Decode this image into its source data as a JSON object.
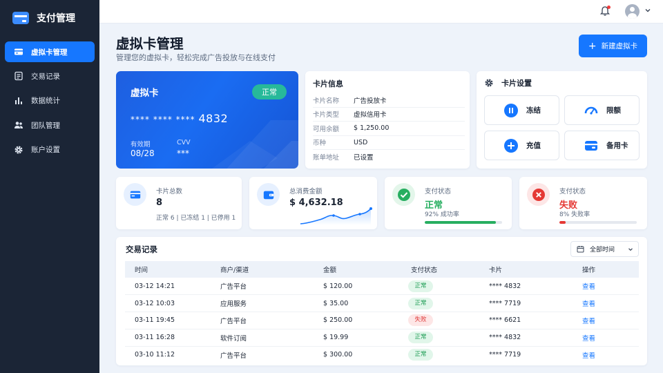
{
  "app": {
    "name": "支付管理"
  },
  "sidebar": {
    "items": [
      {
        "label": "虚拟卡管理",
        "icon": "card-icon",
        "active": true
      },
      {
        "label": "交易记录",
        "icon": "list-icon",
        "active": false
      },
      {
        "label": "数据统计",
        "icon": "bar-chart-icon",
        "active": false
      },
      {
        "label": "团队管理",
        "icon": "team-icon",
        "active": false
      },
      {
        "label": "账户设置",
        "icon": "gear-icon",
        "active": false
      }
    ]
  },
  "header": {
    "title": "虚拟卡管理",
    "subtitle": "管理您的虚拟卡，轻松完成广告投放与在线支付",
    "new_button": "新建虚拟卡"
  },
  "virtual_card": {
    "title": "虚拟卡",
    "status": "正常",
    "masked": "****   ****   ****",
    "last4": "4832",
    "expiry_label": "有效期",
    "expiry": "08/28",
    "cvv_label": "CVV",
    "cvv": "***"
  },
  "card_info": {
    "title": "卡片信息",
    "rows": [
      {
        "key": "卡片名称",
        "value": "广告投放卡"
      },
      {
        "key": "卡片类型",
        "value": "虚拟信用卡"
      },
      {
        "key": "可用余额",
        "value": "$ 1,250.00"
      },
      {
        "key": "币种",
        "value": "USD"
      },
      {
        "key": "账单地址",
        "value": "已设置"
      }
    ]
  },
  "card_settings": {
    "title": "卡片设置",
    "buttons": [
      {
        "label": "冻结",
        "icon": "pause-icon"
      },
      {
        "label": "限额",
        "icon": "gauge-icon"
      },
      {
        "label": "充值",
        "icon": "plus-icon"
      },
      {
        "label": "备用卡",
        "icon": "card-icon"
      }
    ]
  },
  "stats": {
    "total_cards": {
      "label": "卡片总数",
      "value": "8",
      "sub": "正常 6 | 已冻结 1 | 已停用 1"
    },
    "total_spend": {
      "label": "总消费金额",
      "value": "$ 4,632.18"
    },
    "pay_ok": {
      "label": "支付状态",
      "value": "正常",
      "sub": "92% 成功率",
      "progress": 0.92,
      "color": "#27ae60"
    },
    "pay_fail": {
      "label": "支付状态",
      "value": "失败",
      "sub": "8% 失败率",
      "progress": 0.08,
      "color": "#e53935"
    }
  },
  "transactions": {
    "title": "交易记录",
    "filter": "全部时间",
    "columns": [
      "时间",
      "商户/渠道",
      "金额",
      "支付状态",
      "卡片",
      "操作"
    ],
    "rows": [
      {
        "time": "03-12 14:21",
        "merchant": "广告平台",
        "amount": "$ 120.00",
        "status": "正常",
        "card": "**** 4832",
        "action": "查看"
      },
      {
        "time": "03-12 10:03",
        "merchant": "应用服务",
        "amount": "$ 35.00",
        "status": "正常",
        "card": "**** 7719",
        "action": "查看"
      },
      {
        "time": "03-11 19:45",
        "merchant": "广告平台",
        "amount": "$ 250.00",
        "status": "失败",
        "card": "**** 6621",
        "action": "查看"
      },
      {
        "time": "03-11 16:28",
        "merchant": "软件订阅",
        "amount": "$ 19.99",
        "status": "正常",
        "card": "**** 4832",
        "action": "查看"
      },
      {
        "time": "03-10 11:12",
        "merchant": "广告平台",
        "amount": "$ 300.00",
        "status": "正常",
        "card": "**** 7719",
        "action": "查看"
      }
    ]
  },
  "colors": {
    "accent": "#1677ff",
    "sidebar": "#1b2536",
    "success": "#27ae60",
    "danger": "#e53935"
  }
}
